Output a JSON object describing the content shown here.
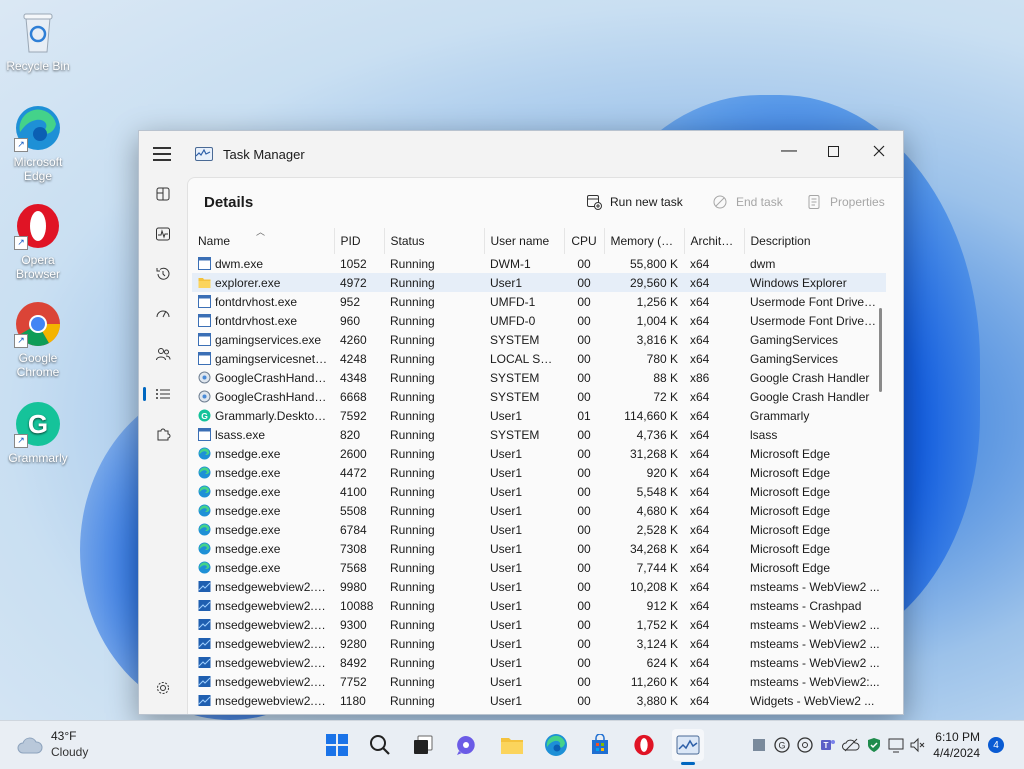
{
  "desktop": {
    "icons": [
      {
        "label": "Recycle Bin"
      },
      {
        "label": "Microsoft Edge"
      },
      {
        "label": "Opera Browser"
      },
      {
        "label": "Google Chrome"
      },
      {
        "label": "Grammarly"
      }
    ]
  },
  "window": {
    "title": "Task Manager",
    "page_title": "Details",
    "commands": {
      "run_new_task": "Run new task",
      "end_task": "End task",
      "properties": "Properties"
    },
    "columns": [
      "Name",
      "PID",
      "Status",
      "User name",
      "CPU",
      "Memory (a...",
      "Archite...",
      "Description"
    ],
    "rows": [
      {
        "name": "dwm.exe",
        "pid": "1052",
        "status": "Running",
        "user": "DWM-1",
        "cpu": "00",
        "mem": "55,800 K",
        "arch": "x64",
        "desc": "dwm",
        "icon": "window"
      },
      {
        "name": "explorer.exe",
        "pid": "4972",
        "status": "Running",
        "user": "User1",
        "cpu": "00",
        "mem": "29,560 K",
        "arch": "x64",
        "desc": "Windows Explorer",
        "icon": "folder"
      },
      {
        "name": "fontdrvhost.exe",
        "pid": "952",
        "status": "Running",
        "user": "UMFD-1",
        "cpu": "00",
        "mem": "1,256 K",
        "arch": "x64",
        "desc": "Usermode Font Driver ...",
        "icon": "window"
      },
      {
        "name": "fontdrvhost.exe",
        "pid": "960",
        "status": "Running",
        "user": "UMFD-0",
        "cpu": "00",
        "mem": "1,004 K",
        "arch": "x64",
        "desc": "Usermode Font Driver ...",
        "icon": "window"
      },
      {
        "name": "gamingservices.exe",
        "pid": "4260",
        "status": "Running",
        "user": "SYSTEM",
        "cpu": "00",
        "mem": "3,816 K",
        "arch": "x64",
        "desc": "GamingServices",
        "icon": "window"
      },
      {
        "name": "gamingservicesnet.e...",
        "pid": "4248",
        "status": "Running",
        "user": "LOCAL SE...",
        "cpu": "00",
        "mem": "780 K",
        "arch": "x64",
        "desc": "GamingServices",
        "icon": "window"
      },
      {
        "name": "GoogleCrashHandler...",
        "pid": "4348",
        "status": "Running",
        "user": "SYSTEM",
        "cpu": "00",
        "mem": "88 K",
        "arch": "x86",
        "desc": "Google Crash Handler",
        "icon": "gear"
      },
      {
        "name": "GoogleCrashHandler...",
        "pid": "6668",
        "status": "Running",
        "user": "SYSTEM",
        "cpu": "00",
        "mem": "72 K",
        "arch": "x64",
        "desc": "Google Crash Handler",
        "icon": "gear"
      },
      {
        "name": "Grammarly.Desktop....",
        "pid": "7592",
        "status": "Running",
        "user": "User1",
        "cpu": "01",
        "mem": "114,660 K",
        "arch": "x64",
        "desc": "Grammarly",
        "icon": "grammarly"
      },
      {
        "name": "lsass.exe",
        "pid": "820",
        "status": "Running",
        "user": "SYSTEM",
        "cpu": "00",
        "mem": "4,736 K",
        "arch": "x64",
        "desc": "lsass",
        "icon": "window"
      },
      {
        "name": "msedge.exe",
        "pid": "2600",
        "status": "Running",
        "user": "User1",
        "cpu": "00",
        "mem": "31,268 K",
        "arch": "x64",
        "desc": "Microsoft Edge",
        "icon": "edge"
      },
      {
        "name": "msedge.exe",
        "pid": "4472",
        "status": "Running",
        "user": "User1",
        "cpu": "00",
        "mem": "920 K",
        "arch": "x64",
        "desc": "Microsoft Edge",
        "icon": "edge"
      },
      {
        "name": "msedge.exe",
        "pid": "4100",
        "status": "Running",
        "user": "User1",
        "cpu": "00",
        "mem": "5,548 K",
        "arch": "x64",
        "desc": "Microsoft Edge",
        "icon": "edge"
      },
      {
        "name": "msedge.exe",
        "pid": "5508",
        "status": "Running",
        "user": "User1",
        "cpu": "00",
        "mem": "4,680 K",
        "arch": "x64",
        "desc": "Microsoft Edge",
        "icon": "edge"
      },
      {
        "name": "msedge.exe",
        "pid": "6784",
        "status": "Running",
        "user": "User1",
        "cpu": "00",
        "mem": "2,528 K",
        "arch": "x64",
        "desc": "Microsoft Edge",
        "icon": "edge"
      },
      {
        "name": "msedge.exe",
        "pid": "7308",
        "status": "Running",
        "user": "User1",
        "cpu": "00",
        "mem": "34,268 K",
        "arch": "x64",
        "desc": "Microsoft Edge",
        "icon": "edge"
      },
      {
        "name": "msedge.exe",
        "pid": "7568",
        "status": "Running",
        "user": "User1",
        "cpu": "00",
        "mem": "7,744 K",
        "arch": "x64",
        "desc": "Microsoft Edge",
        "icon": "edge"
      },
      {
        "name": "msedgewebview2.exe",
        "pid": "9980",
        "status": "Running",
        "user": "User1",
        "cpu": "00",
        "mem": "10,208 K",
        "arch": "x64",
        "desc": "msteams - WebView2 ...",
        "icon": "webview"
      },
      {
        "name": "msedgewebview2.exe",
        "pid": "10088",
        "status": "Running",
        "user": "User1",
        "cpu": "00",
        "mem": "912 K",
        "arch": "x64",
        "desc": "msteams - Crashpad",
        "icon": "webview"
      },
      {
        "name": "msedgewebview2.exe",
        "pid": "9300",
        "status": "Running",
        "user": "User1",
        "cpu": "00",
        "mem": "1,752 K",
        "arch": "x64",
        "desc": "msteams - WebView2 ...",
        "icon": "webview"
      },
      {
        "name": "msedgewebview2.exe",
        "pid": "9280",
        "status": "Running",
        "user": "User1",
        "cpu": "00",
        "mem": "3,124 K",
        "arch": "x64",
        "desc": "msteams - WebView2 ...",
        "icon": "webview"
      },
      {
        "name": "msedgewebview2.exe",
        "pid": "8492",
        "status": "Running",
        "user": "User1",
        "cpu": "00",
        "mem": "624 K",
        "arch": "x64",
        "desc": "msteams - WebView2 ...",
        "icon": "webview"
      },
      {
        "name": "msedgewebview2.exe",
        "pid": "7752",
        "status": "Running",
        "user": "User1",
        "cpu": "00",
        "mem": "11,260 K",
        "arch": "x64",
        "desc": "msteams - WebView2:...",
        "icon": "webview"
      },
      {
        "name": "msedgewebview2.exe",
        "pid": "1180",
        "status": "Running",
        "user": "User1",
        "cpu": "00",
        "mem": "3,880 K",
        "arch": "x64",
        "desc": "Widgets - WebView2 ...",
        "icon": "webview"
      }
    ]
  },
  "taskbar": {
    "weather_temp": "43°F",
    "weather_desc": "Cloudy",
    "time": "6:10 PM",
    "date": "4/4/2024",
    "notification_count": "4"
  },
  "colors": {
    "accent": "#0067c0",
    "selected_row": "#e6eef8"
  }
}
